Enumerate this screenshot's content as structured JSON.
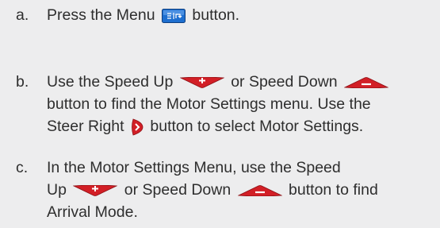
{
  "steps": [
    {
      "letter": "a.",
      "lines": [
        [
          "Press the Menu",
          "button."
        ]
      ]
    },
    {
      "letter": "b.",
      "lines": [
        [
          "Use the Speed Up",
          "or Speed Down",
          ""
        ],
        [
          "button to find the Motor Settings menu. Use the"
        ],
        [
          "Steer Right",
          "button to select Motor Settings."
        ]
      ]
    },
    {
      "letter": "c.",
      "lines": [
        [
          "In the Motor Settings Menu, use the Speed"
        ],
        [
          "Up",
          "or Speed Down",
          "button to find"
        ],
        [
          "Arrival Mode."
        ]
      ]
    }
  ],
  "icons": {
    "menu": "menu-button-icon",
    "speed_up": "speed-up-button-icon",
    "speed_down": "speed-down-button-icon",
    "steer_right": "steer-right-button-icon"
  },
  "colors": {
    "background": "#ededee",
    "text": "#2e2e2e",
    "button_red": "#d21f26",
    "menu_blue": "#1e6fd0"
  }
}
